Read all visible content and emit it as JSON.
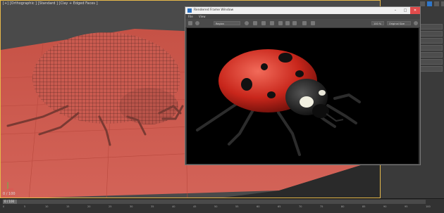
{
  "viewport": {
    "label": "[+] [Orthographic ] [Standard ] [Clay + Edged Faces ]",
    "frame_label": "0 / 100"
  },
  "render_window": {
    "title": "Rendered Frame Window",
    "menu": [
      "File",
      "View"
    ],
    "area_to_render": "Region",
    "zoom": "100 %",
    "view_mode": "Original Size"
  },
  "right_panel": {
    "buttons": [
      "",
      "",
      "",
      "",
      "",
      "",
      "",
      "",
      "",
      ""
    ]
  },
  "timeline": {
    "ticks": [
      "0",
      "5",
      "10",
      "15",
      "20",
      "25",
      "30",
      "35",
      "40",
      "45",
      "50",
      "55",
      "60",
      "65",
      "70",
      "75",
      "80",
      "85",
      "90",
      "95",
      "100"
    ]
  },
  "colors": {
    "ground": "#c9584d",
    "ladybug_shell": "#d8362a",
    "viewport_border": "#e6b84a"
  },
  "icons": [
    "minimize-icon",
    "maximize-icon",
    "close-icon",
    "save-icon",
    "render-icon",
    "settings-icon"
  ]
}
